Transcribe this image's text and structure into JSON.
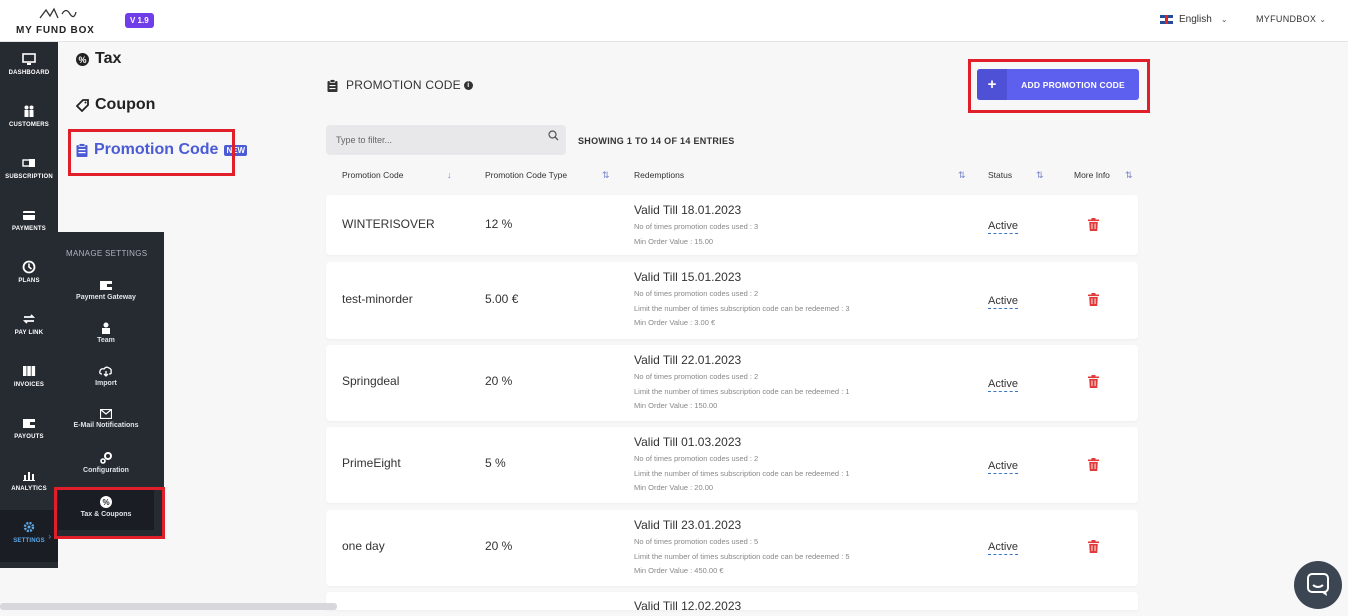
{
  "app": {
    "logo_text": "MY FUND BOX",
    "version": "V 1.9"
  },
  "topbar": {
    "language": "English",
    "user": "MYFUNDBOX"
  },
  "sidebar": {
    "items": [
      {
        "label": "DASHBOARD",
        "icon": "monitor-icon"
      },
      {
        "label": "CUSTOMERS",
        "icon": "users-icon"
      },
      {
        "label": "SUBSCRIPTION",
        "icon": "subscription-icon"
      },
      {
        "label": "PAYMENTS",
        "icon": "credit-card-icon"
      },
      {
        "label": "PLANS",
        "icon": "plans-icon"
      },
      {
        "label": "PAY LINK",
        "icon": "exchange-icon"
      },
      {
        "label": "INVOICES",
        "icon": "invoices-icon"
      },
      {
        "label": "PAYOUTS",
        "icon": "wallet-icon"
      },
      {
        "label": "ANALYTICS",
        "icon": "bar-chart-icon"
      },
      {
        "label": "SETTINGS",
        "icon": "gear-icon"
      }
    ]
  },
  "manage_settings": {
    "title": "MANAGE SETTINGS",
    "items": [
      {
        "label": "Payment Gateway",
        "icon": "wallet-icon"
      },
      {
        "label": "Team",
        "icon": "team-icon"
      },
      {
        "label": "Import",
        "icon": "cloud-download-icon"
      },
      {
        "label": "E-Mail Notifications",
        "icon": "envelope-icon"
      },
      {
        "label": "Configuration",
        "icon": "configuration-icon"
      },
      {
        "label": "Tax & Coupons",
        "icon": "percent-icon"
      }
    ]
  },
  "subnav": {
    "tax": "Tax",
    "coupon": "Coupon",
    "promotion_code": "Promotion Code",
    "new_badge": "NEW"
  },
  "main": {
    "title": "PROMOTION CODE",
    "add_button": "ADD PROMOTION CODE",
    "filter_placeholder": "Type to filter...",
    "showing": "SHOWING 1 TO 14 OF 14 ENTRIES",
    "columns": [
      "Promotion Code",
      "Promotion Code Type",
      "Redemptions",
      "Status",
      "More Info"
    ],
    "rows": [
      {
        "code": "WINTERISOVER",
        "type": "12 %",
        "valid": "Valid Till 18.01.2023",
        "lines": [
          "No of times promotion codes used : 3",
          "Min Order Value : 15.00"
        ],
        "status": "Active"
      },
      {
        "code": "test-minorder",
        "type": "5.00 €",
        "valid": "Valid Till 15.01.2023",
        "lines": [
          "No of times promotion codes used : 2",
          "Limit the number of times subscription code can be redeemed : 3",
          "Min Order Value : 3.00 €"
        ],
        "status": "Active"
      },
      {
        "code": "Springdeal",
        "type": "20 %",
        "valid": "Valid Till 22.01.2023",
        "lines": [
          "No of times promotion codes used : 2",
          "Limit the number of times subscription code can be redeemed : 1",
          "Min Order Value : 150.00"
        ],
        "status": "Active"
      },
      {
        "code": "PrimeEight",
        "type": "5 %",
        "valid": "Valid Till 01.03.2023",
        "lines": [
          "No of times promotion codes used : 2",
          "Limit the number of times subscription code can be redeemed : 1",
          "Min Order Value : 20.00"
        ],
        "status": "Active"
      },
      {
        "code": "one day",
        "type": "20 %",
        "valid": "Valid Till 23.01.2023",
        "lines": [
          "No of times promotion codes used : 5",
          "Limit the number of times subscription code can be redeemed : 5",
          "Min Order Value : 450.00 €"
        ],
        "status": "Active"
      },
      {
        "code": "",
        "type": "",
        "valid": "Valid Till 12.02.2023",
        "lines": [],
        "status": ""
      }
    ]
  },
  "colors": {
    "accent": "#5d5fef",
    "sidebar": "#262b32",
    "highlight": "#e01f2b",
    "delete": "#e03a3a",
    "active_link": "#4b5bd6"
  }
}
